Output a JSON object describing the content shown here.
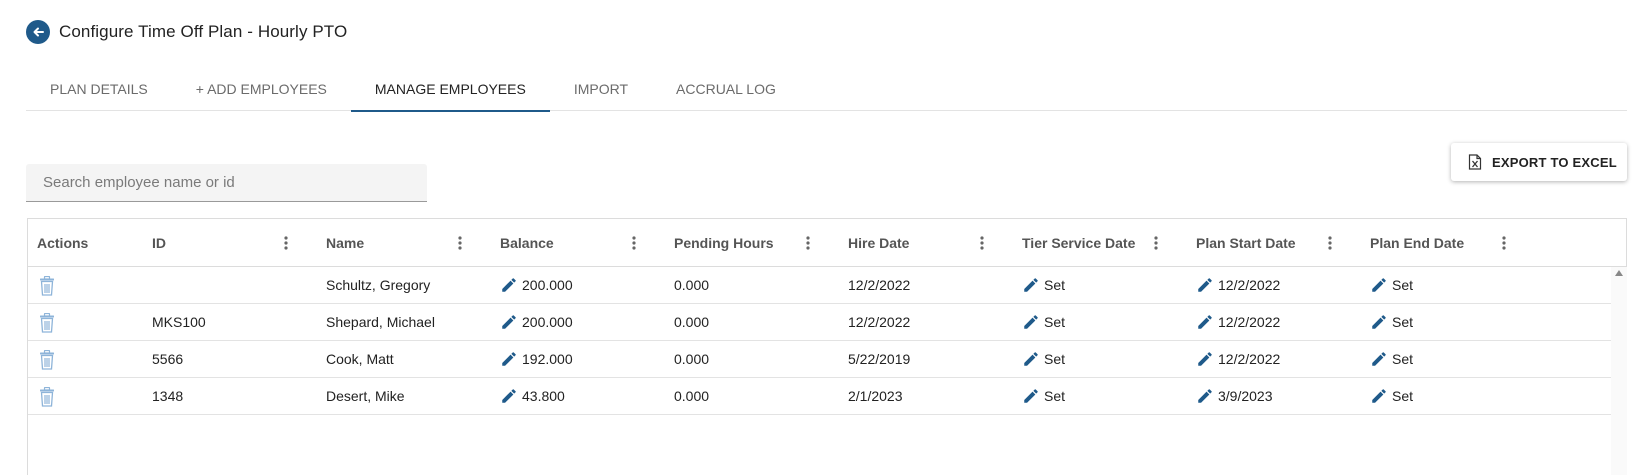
{
  "page": {
    "title": "Configure Time Off Plan - Hourly PTO",
    "accent_color": "#1f5a8a"
  },
  "tabs": [
    {
      "label": "PLAN DETAILS",
      "active": false
    },
    {
      "label": "+ ADD EMPLOYEES",
      "active": false
    },
    {
      "label": "MANAGE EMPLOYEES",
      "active": true
    },
    {
      "label": "IMPORT",
      "active": false
    },
    {
      "label": "ACCRUAL LOG",
      "active": false
    }
  ],
  "search": {
    "placeholder": "Search employee name or id",
    "value": ""
  },
  "export": {
    "label": "EXPORT TO EXCEL",
    "icon": "excel-file-icon"
  },
  "grid": {
    "columns": [
      "Actions",
      "ID",
      "Name",
      "Balance",
      "Pending Hours",
      "Hire Date",
      "Tier Service Date",
      "Plan Start Date",
      "Plan End Date"
    ],
    "rows": [
      {
        "id": "",
        "name": "Schultz, Gregory",
        "balance": "200.000",
        "pending": "0.000",
        "hire": "12/2/2022",
        "tier": "Set",
        "start": "12/2/2022",
        "end": "Set"
      },
      {
        "id": "MKS100",
        "name": "Shepard, Michael",
        "balance": "200.000",
        "pending": "0.000",
        "hire": "12/2/2022",
        "tier": "Set",
        "start": "12/2/2022",
        "end": "Set"
      },
      {
        "id": "5566",
        "name": "Cook, Matt",
        "balance": "192.000",
        "pending": "0.000",
        "hire": "5/22/2019",
        "tier": "Set",
        "start": "12/2/2022",
        "end": "Set"
      },
      {
        "id": "1348",
        "name": "Desert, Mike",
        "balance": "43.800",
        "pending": "0.000",
        "hire": "2/1/2023",
        "tier": "Set",
        "start": "3/9/2023",
        "end": "Set"
      }
    ]
  }
}
